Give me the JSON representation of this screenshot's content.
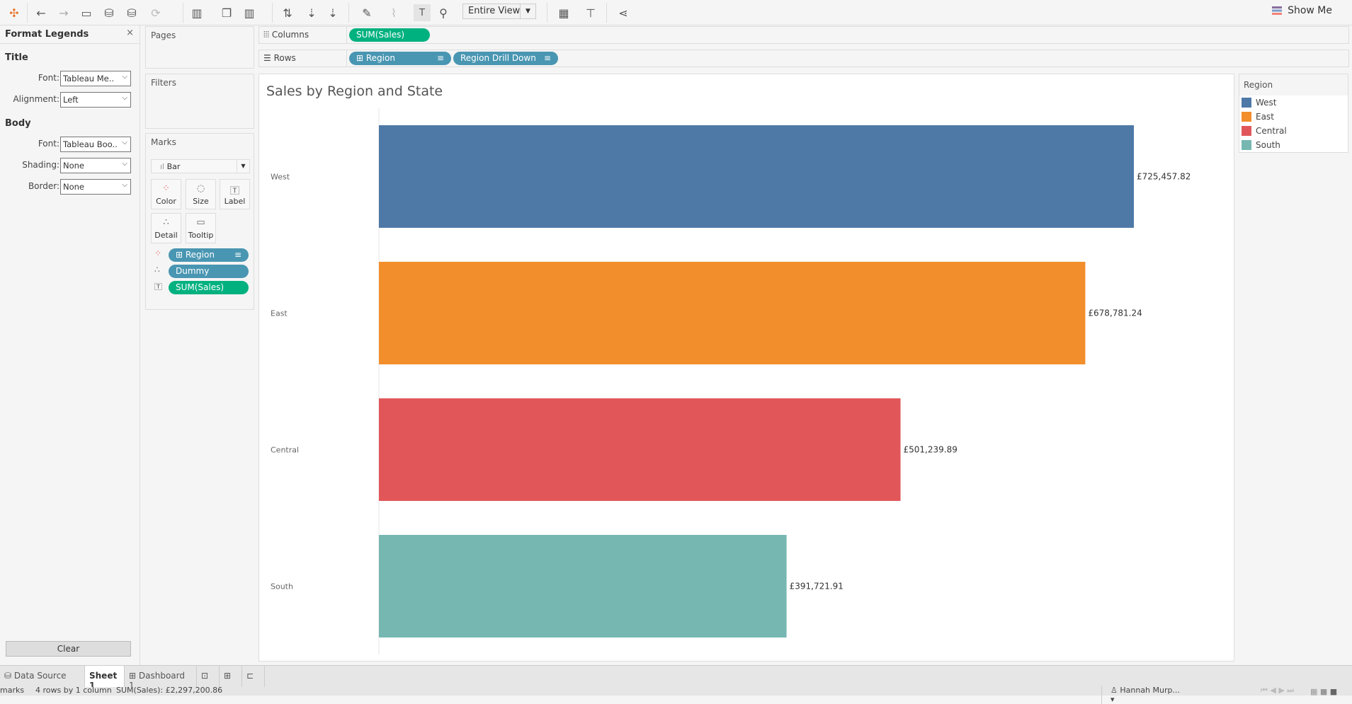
{
  "toolbar": {
    "view_dropdown": "Entire View",
    "show_me": "Show Me"
  },
  "format_panel": {
    "title": "Format Legends",
    "close": "×",
    "title_section": "Title",
    "body_section": "Body",
    "fields": [
      {
        "label": "Font:",
        "value": "Tableau Me.."
      },
      {
        "label": "Alignment:",
        "value": "Left"
      },
      {
        "label": "Font:",
        "value": "Tableau Boo.."
      },
      {
        "label": "Shading:",
        "value": "None"
      },
      {
        "label": "Border:",
        "value": "None"
      }
    ],
    "clear": "Clear"
  },
  "cards": {
    "pages": "Pages",
    "filters": "Filters",
    "marks": "Marks",
    "mark_type": "Bar",
    "buttons": [
      "Color",
      "Size",
      "Label",
      "Detail",
      "Tooltip"
    ],
    "pills": [
      "Region",
      "Dummy",
      "SUM(Sales)"
    ]
  },
  "shelves": {
    "columns_label": "Columns",
    "rows_label": "Rows",
    "columns_pills": [
      "SUM(Sales)"
    ],
    "rows_pills": [
      "Region",
      "Region Drill Down"
    ]
  },
  "legend": {
    "title": "Region",
    "items": [
      {
        "label": "West",
        "color": "#4e79a7"
      },
      {
        "label": "East",
        "color": "#f28e2b"
      },
      {
        "label": "Central",
        "color": "#e15759"
      },
      {
        "label": "South",
        "color": "#76b7b2"
      }
    ]
  },
  "chart_data": {
    "type": "bar",
    "orientation": "horizontal",
    "title": "Sales by Region and State",
    "categories": [
      "West",
      "East",
      "Central",
      "South"
    ],
    "values": [
      725457.82,
      678781.24,
      501239.89,
      391721.91
    ],
    "labels": [
      "£725,457.82",
      "£678,781.24",
      "£501,239.89",
      "£391,721.91"
    ],
    "colors": [
      "#4e79a7",
      "#f28e2b",
      "#e15759",
      "#76b7b2"
    ],
    "xlim": [
      0,
      725457.82
    ]
  },
  "tabs": {
    "data_source": "Data Source",
    "sheet1": "Sheet 1",
    "dashboard1": "Dashboard 1"
  },
  "status": {
    "marks": "marks",
    "rows_cols": "4 rows by 1 column",
    "sum": "SUM(Sales): £2,297,200.86",
    "user": "Hannah Murp..."
  }
}
